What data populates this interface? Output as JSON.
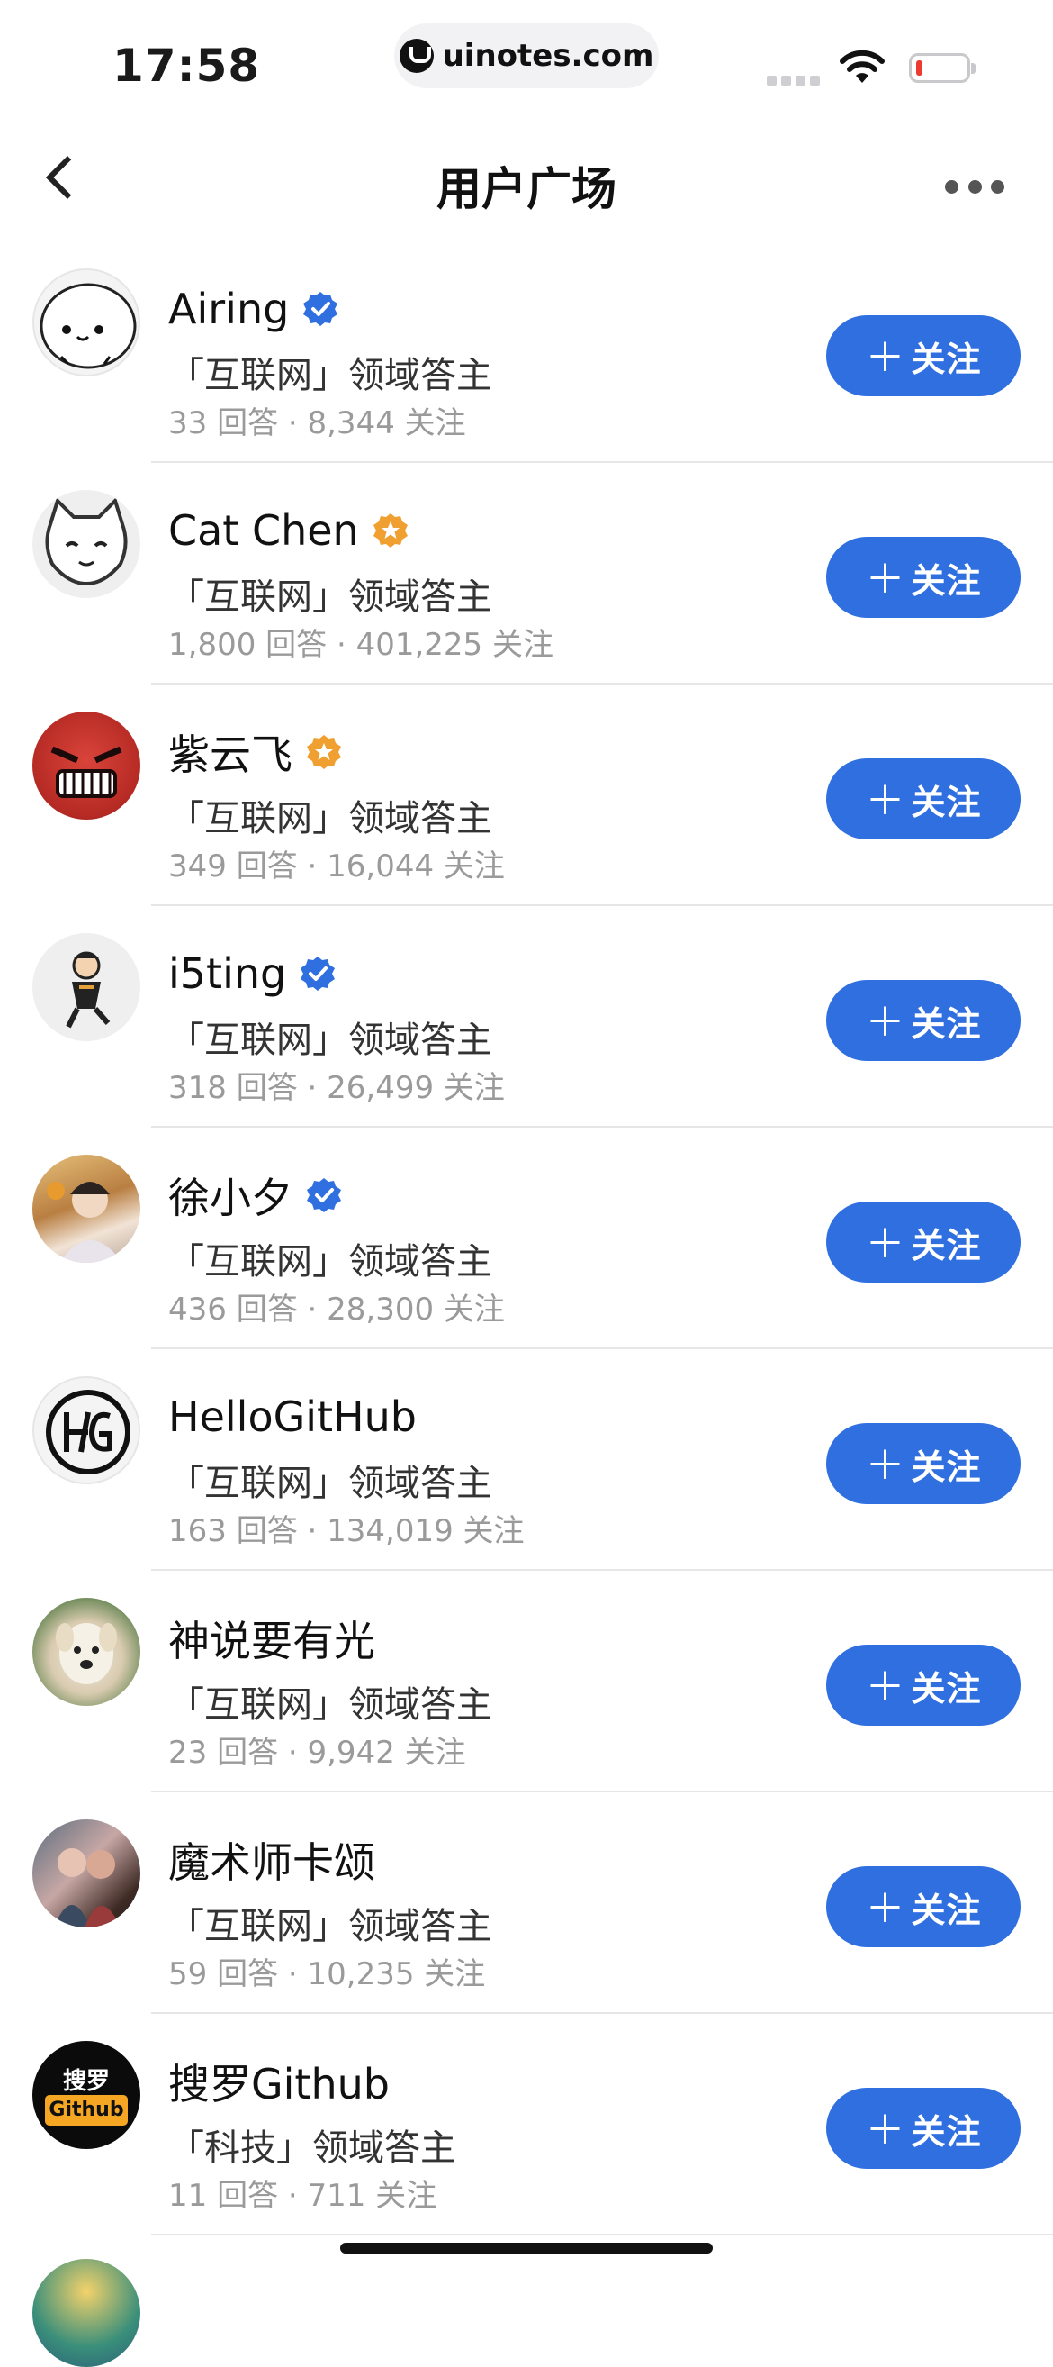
{
  "status_bar": {
    "time": "17:58",
    "url": "uinotes.com"
  },
  "nav": {
    "title": "用户广场",
    "back_icon": "chevron-left-icon",
    "more_icon": "more-dots-icon"
  },
  "colors": {
    "accent": "#2f6fe0",
    "verified_blue": "#2f6fe0",
    "verified_gold": "#f0a030",
    "battery_low": "#ec3b30"
  },
  "users": [
    {
      "name": "Airing",
      "badge": "verified-blue",
      "desc": "「互联网」领域答主",
      "stats": "33 回答 · 8,344 关注",
      "button": "关注"
    },
    {
      "name": "Cat Chen",
      "badge": "verified-gold",
      "desc": "「互联网」领域答主",
      "stats": "1,800 回答 · 401,225 关注",
      "button": "关注"
    },
    {
      "name": "紫云飞",
      "badge": "verified-gold",
      "desc": "「互联网」领域答主",
      "stats": "349 回答 · 16,044 关注",
      "button": "关注"
    },
    {
      "name": "i5ting",
      "badge": "verified-blue",
      "desc": "「互联网」领域答主",
      "stats": "318 回答 · 26,499 关注",
      "button": "关注"
    },
    {
      "name": "徐小夕",
      "badge": "verified-blue",
      "desc": "「互联网」领域答主",
      "stats": "436 回答 · 28,300 关注",
      "button": "关注"
    },
    {
      "name": "HelloGitHub",
      "badge": "",
      "desc": "「互联网」领域答主",
      "stats": "163 回答 · 134,019 关注",
      "button": "关注"
    },
    {
      "name": "神说要有光",
      "badge": "",
      "desc": "「互联网」领域答主",
      "stats": "23 回答 · 9,942 关注",
      "button": "关注"
    },
    {
      "name": "魔术师卡颂",
      "badge": "",
      "desc": "「互联网」领域答主",
      "stats": "59 回答 · 10,235 关注",
      "button": "关注"
    },
    {
      "name": "搜罗Github",
      "badge": "",
      "desc": "「科技」领域答主",
      "stats": "11 回答 · 711 关注",
      "button": "关注"
    }
  ],
  "avatar_logo_text": {
    "soluo_top": "搜罗",
    "soluo_bottom": "Github"
  }
}
